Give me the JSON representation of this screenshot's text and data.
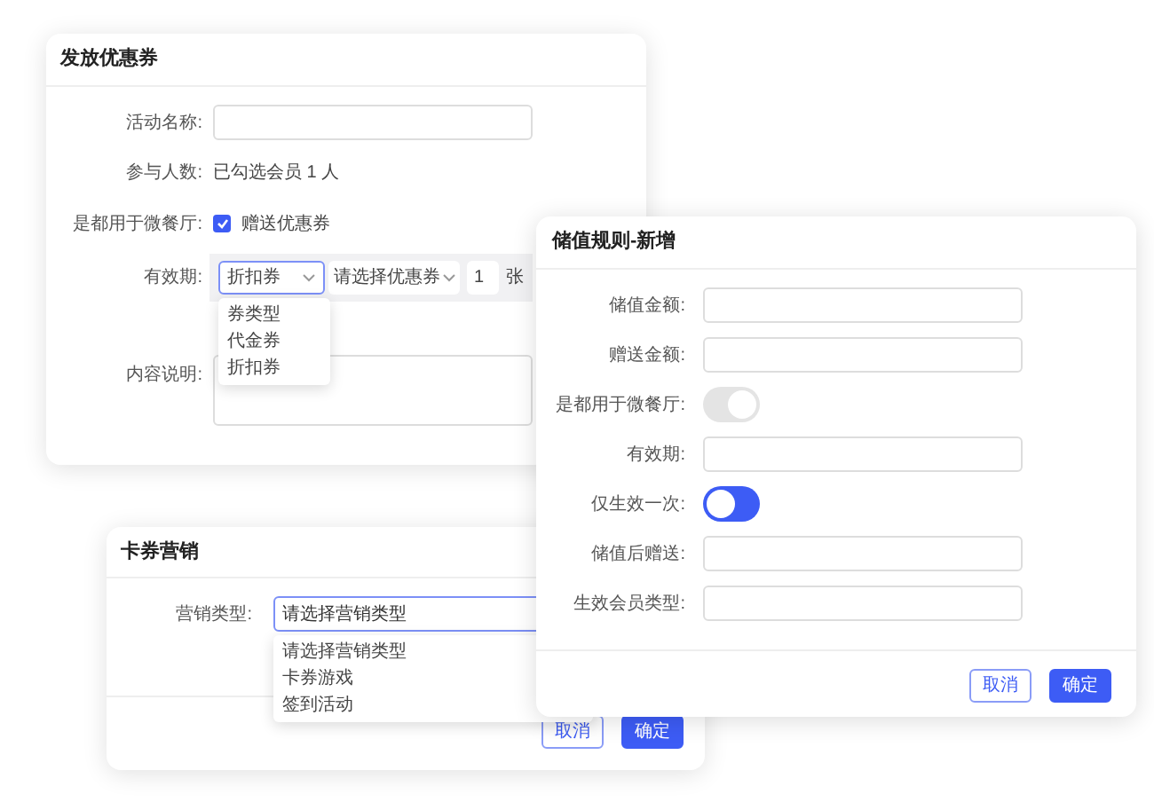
{
  "coupon_dialog": {
    "title": "发放优惠券",
    "activity_name": {
      "label": "活动名称:"
    },
    "participants": {
      "label": "参与人数:",
      "value": "已勾选会员 1 人"
    },
    "micro_restaurant": {
      "label": "是都用于微餐厅:",
      "checked": true,
      "option": "赠送优惠券"
    },
    "validity": {
      "label": "有效期:",
      "type_select": {
        "value": "折扣券",
        "open": true,
        "options": [
          "券类型",
          "代金券",
          "折扣券"
        ]
      },
      "coupon_select": {
        "value": "请选择优惠券"
      },
      "quantity": "1",
      "unit": "张"
    },
    "description": {
      "label": "内容说明:"
    }
  },
  "marketing_dialog": {
    "title": "卡券营销",
    "type_select": {
      "label": "营销类型:",
      "value": "请选择营销类型",
      "open": true,
      "options": [
        "请选择营销类型",
        "卡券游戏",
        "签到活动"
      ]
    },
    "buttons": [
      {
        "label": "取消",
        "kind": "secondary"
      },
      {
        "label": "确定",
        "kind": "primary"
      }
    ]
  },
  "stored_value_dialog": {
    "title": "储值规则-新增",
    "fields": [
      {
        "label": "储值金额:",
        "kind": "input"
      },
      {
        "label": "赠送金额:",
        "kind": "input"
      },
      {
        "label": "是都用于微餐厅:",
        "kind": "toggle",
        "on": true,
        "color": "#e4e4e4"
      },
      {
        "label": "有效期:",
        "kind": "input"
      },
      {
        "label": "仅生效一次:",
        "kind": "toggle",
        "on": false,
        "color": "#3d5cf5"
      },
      {
        "label": "储值后赠送:",
        "kind": "input"
      },
      {
        "label": "生效会员类型:",
        "kind": "input"
      }
    ],
    "buttons": [
      {
        "label": "取消",
        "kind": "secondary"
      },
      {
        "label": "确定",
        "kind": "primary"
      }
    ]
  }
}
